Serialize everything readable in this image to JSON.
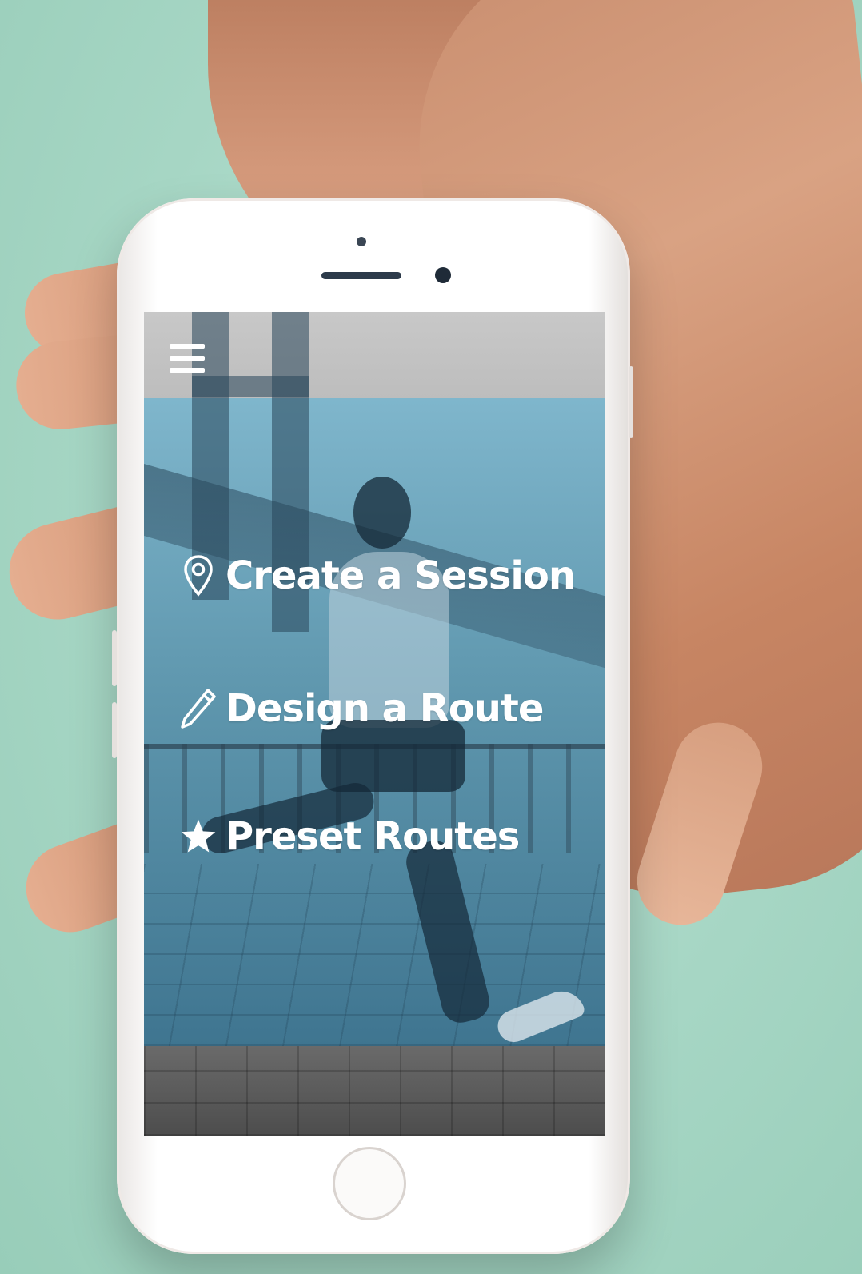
{
  "app": {
    "menu": {
      "items": [
        {
          "label": "Create a Session",
          "icon": "map-pin-icon"
        },
        {
          "label": "Design a Route",
          "icon": "pencil-icon"
        },
        {
          "label": "Preset Routes",
          "icon": "star-icon"
        }
      ]
    }
  },
  "colors": {
    "background": "#a9d9c8",
    "overlay_tint": "#6fa8bf",
    "text": "#ffffff"
  }
}
